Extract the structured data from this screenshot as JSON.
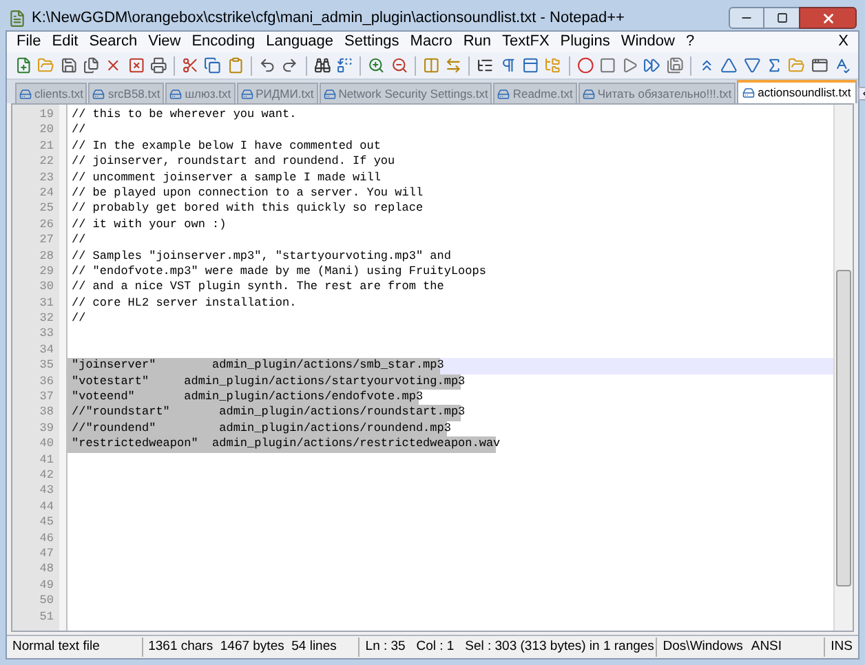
{
  "window": {
    "title": "K:\\NewGGDM\\orangebox\\cstrike\\cfg\\mani_admin_plugin\\actionsoundlist.txt - Notepad++"
  },
  "menu": {
    "items": [
      "File",
      "Edit",
      "Search",
      "View",
      "Encoding",
      "Language",
      "Settings",
      "Macro",
      "Run",
      "TextFX",
      "Plugins",
      "Window",
      "?"
    ],
    "close_label": "X"
  },
  "tabs": [
    {
      "label": "clients.txt",
      "selected": false
    },
    {
      "label": "srcB58.txt",
      "selected": false
    },
    {
      "label": "шлюз.txt",
      "selected": false
    },
    {
      "label": "РИДМИ.txt",
      "selected": false
    },
    {
      "label": "Network Security Settings.txt",
      "selected": false
    },
    {
      "label": "Readme.txt",
      "selected": false
    },
    {
      "label": "Читать обязательно!!!.txt",
      "selected": false
    },
    {
      "label": "actionsoundlist.txt",
      "selected": true
    }
  ],
  "editor": {
    "lines": [
      {
        "number": "19",
        "text": "// this to be wherever you want.",
        "selected": false,
        "current": false
      },
      {
        "number": "20",
        "text": "//",
        "selected": false,
        "current": false
      },
      {
        "number": "21",
        "text": "// In the example below I have commented out",
        "selected": false,
        "current": false
      },
      {
        "number": "22",
        "text": "// joinserver, roundstart and roundend. If you",
        "selected": false,
        "current": false
      },
      {
        "number": "23",
        "text": "// uncomment joinserver a sample I made will",
        "selected": false,
        "current": false
      },
      {
        "number": "24",
        "text": "// be played upon connection to a server. You will",
        "selected": false,
        "current": false
      },
      {
        "number": "25",
        "text": "// probably get bored with this quickly so replace",
        "selected": false,
        "current": false
      },
      {
        "number": "26",
        "text": "// it with your own :)",
        "selected": false,
        "current": false
      },
      {
        "number": "27",
        "text": "//",
        "selected": false,
        "current": false
      },
      {
        "number": "28",
        "text": "// Samples \"joinserver.mp3\", \"startyourvoting.mp3\" and",
        "selected": false,
        "current": false
      },
      {
        "number": "29",
        "text": "// \"endofvote.mp3\" were made by me (Mani) using FruityLoops",
        "selected": false,
        "current": false
      },
      {
        "number": "30",
        "text": "// and a nice VST plugin synth. The rest are from the",
        "selected": false,
        "current": false
      },
      {
        "number": "31",
        "text": "// core HL2 server installation.",
        "selected": false,
        "current": false
      },
      {
        "number": "32",
        "text": "//",
        "selected": false,
        "current": false
      },
      {
        "number": "33"
      },
      {
        "number": "34"
      },
      {
        "number": "35",
        "text": "\"joinserver\"        admin_plugin/actions/smb_star.mp3",
        "selected": true,
        "current": true
      },
      {
        "number": "36",
        "text": "\"votestart\"     admin_plugin/actions/startyourvoting.mp3",
        "selected": true,
        "current": false
      },
      {
        "number": "37",
        "text": "\"voteend\"       admin_plugin/actions/endofvote.mp3",
        "selected": true,
        "current": false
      },
      {
        "number": "38",
        "text": "//\"roundstart\"       admin_plugin/actions/roundstart.mp3",
        "selected": true,
        "current": false
      },
      {
        "number": "39",
        "text": "//\"roundend\"         admin_plugin/actions/roundend.mp3",
        "selected": true,
        "current": false
      },
      {
        "number": "40",
        "text": "\"restrictedweapon\"  admin_plugin/actions/restrictedweapon.wav",
        "selected": true,
        "current": false
      },
      {
        "number": "41"
      },
      {
        "number": "42"
      },
      {
        "number": "43"
      },
      {
        "number": "44"
      },
      {
        "number": "45"
      },
      {
        "number": "46"
      },
      {
        "number": "47"
      },
      {
        "number": "48"
      },
      {
        "number": "49"
      },
      {
        "number": "50"
      },
      {
        "number": "51"
      }
    ]
  },
  "status_bar": {
    "file_type": "Normal text file",
    "stats": "1361 chars  1467 bytes  54 lines",
    "position": "Ln : 35   Col : 1   Sel : 303 (313 bytes) in 1 ranges",
    "eol": "Dos\\Windows",
    "encoding": "ANSI",
    "mode": "INS"
  }
}
